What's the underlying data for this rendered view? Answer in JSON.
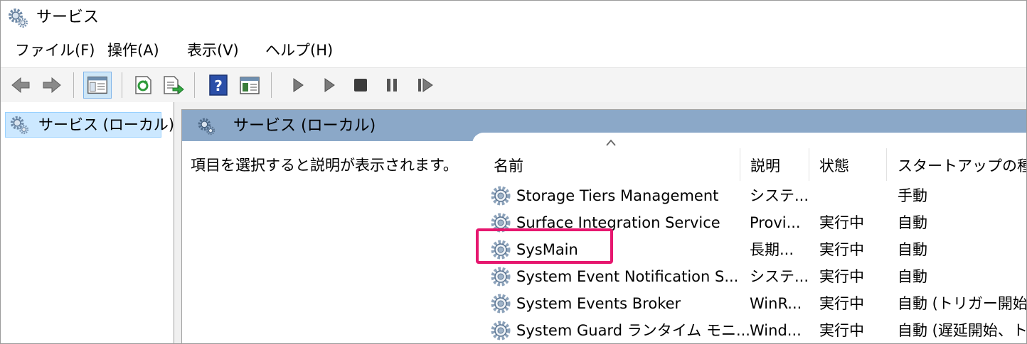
{
  "window": {
    "title": "サービス",
    "title_icon": "gear-icon"
  },
  "menu": [
    {
      "label": "ファイル(F)"
    },
    {
      "label": "操作(A)"
    },
    {
      "label": "表示(V)"
    },
    {
      "label": "ヘルプ(H)"
    }
  ],
  "toolbar": [
    {
      "name": "back-icon"
    },
    {
      "name": "forward-icon"
    },
    {
      "name": "show-hide-console-tree-icon",
      "selected": true
    },
    {
      "name": "refresh-icon"
    },
    {
      "name": "export-list-icon"
    },
    {
      "name": "help-icon"
    },
    {
      "name": "properties-icon"
    },
    {
      "name": "start-service-icon"
    },
    {
      "name": "start-service-alt-icon"
    },
    {
      "name": "stop-service-icon"
    },
    {
      "name": "pause-service-icon"
    },
    {
      "name": "resume-service-icon"
    }
  ],
  "tree": {
    "selected_label": "サービス (ローカル)",
    "icon": "gear-icon"
  },
  "pane": {
    "header_label": "サービス (ローカル)",
    "description_hint": "項目を選択すると説明が表示されます。"
  },
  "columns": {
    "name": "名前",
    "description": "説明",
    "status": "状態",
    "startup": "スタートアップの種類"
  },
  "services": [
    {
      "name": "Storage Tiers Management",
      "description": "システ...",
      "status": "",
      "startup": "手動"
    },
    {
      "name": "Surface Integration Service",
      "description": "Provi...",
      "status": "実行中",
      "startup": "自動"
    },
    {
      "name": "SysMain",
      "description": "長期...",
      "status": "実行中",
      "startup": "自動",
      "highlighted": true
    },
    {
      "name": "System Event Notification S...",
      "description": "システ...",
      "status": "実行中",
      "startup": "自動"
    },
    {
      "name": "System Events Broker",
      "description": "WinR...",
      "status": "実行中",
      "startup": "自動 (トリガー開始)"
    },
    {
      "name": "System Guard ランタイム モニ...",
      "description": "Wind...",
      "status": "実行中",
      "startup": "自動 (遅延開始、トリガー開始)"
    }
  ],
  "colors": {
    "pane_header": "#8ba8c8",
    "tree_selection": "#cce8ff",
    "highlight_box": "#e6176f"
  }
}
